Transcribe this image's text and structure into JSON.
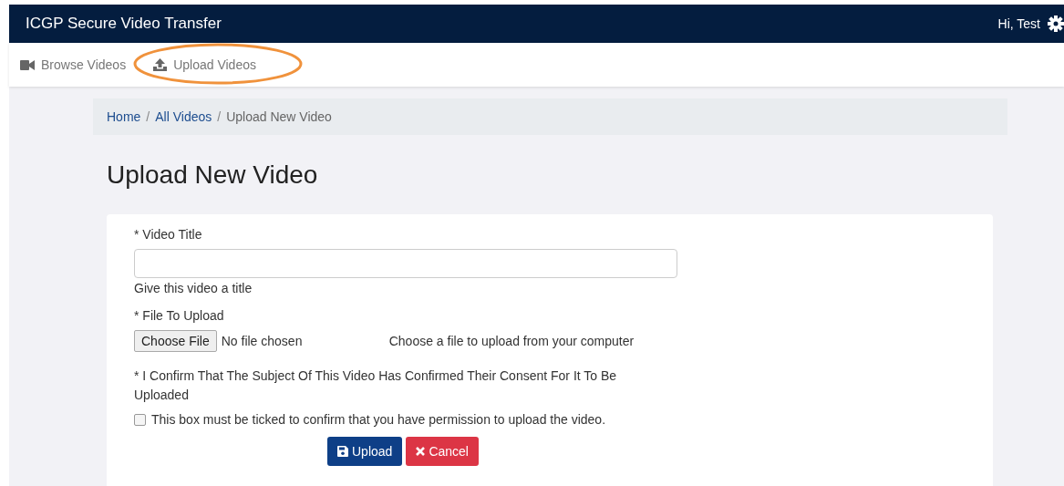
{
  "app_bar": {
    "title": "ICGP Secure Video Transfer",
    "greeting": "Hi, Test"
  },
  "nav": [
    {
      "label": "Browse Videos",
      "selected": false,
      "highlighted": false
    },
    {
      "label": "Upload Videos",
      "selected": false,
      "highlighted": true
    }
  ],
  "breadcrumb": [
    {
      "label": "Home",
      "link": true
    },
    {
      "separator": "/",
      "label": "All Videos",
      "link": true
    },
    {
      "separator": "/",
      "label": "Upload New Video",
      "link": false
    }
  ],
  "heading": "Upload New Video",
  "form": {
    "title_label": "* Video Title",
    "title_help": "Give this video a title",
    "file_label": "* File To Upload",
    "file_button": "Choose File",
    "file_status": "No file chosen",
    "file_help": "Choose a file to upload from your computer",
    "consent_label": "* I Confirm That The Subject Of This Video Has Confirmed Their Consent For It To Be Uploaded",
    "consent_checkbox": {
      "label": "This box must be ticked to confirm that you have permission to upload the video.",
      "checked": false
    },
    "buttons": [
      {
        "label": "Upload",
        "kind": "primary"
      },
      {
        "label": "Cancel",
        "kind": "danger"
      }
    ]
  }
}
